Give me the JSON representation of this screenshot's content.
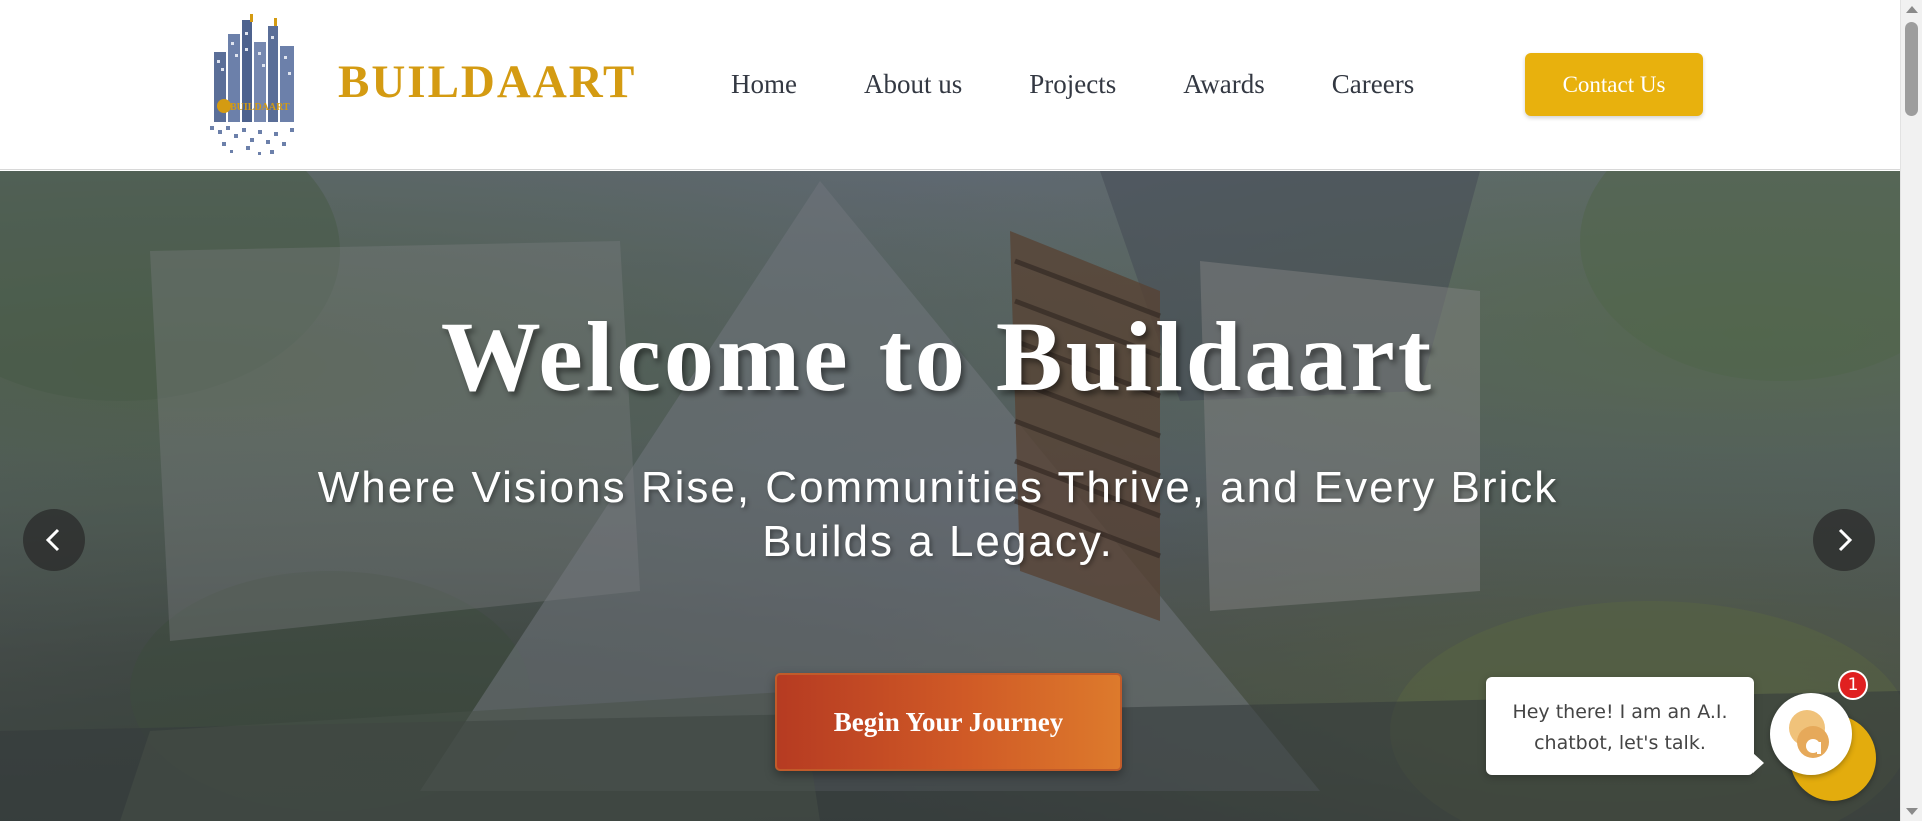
{
  "header": {
    "brand": "BUILDAART",
    "logo_mark_text": "BUILDAART",
    "nav": [
      {
        "label": "Home"
      },
      {
        "label": "About us"
      },
      {
        "label": "Projects"
      },
      {
        "label": "Awards"
      },
      {
        "label": "Careers"
      }
    ],
    "contact_label": "Contact Us"
  },
  "hero": {
    "title": "Welcome to Buildaart",
    "subtitle": "Where Visions Rise, Communities Thrive, and Every Brick Builds a Legacy.",
    "cta_label": "Begin Your Journey",
    "prev_icon": "chevron-left-icon",
    "next_icon": "chevron-right-icon"
  },
  "chat": {
    "message": "Hey there! I am an A.I. chatbot, let's talk.",
    "badge_count": "1"
  },
  "colors": {
    "brand_gold": "#d49b12",
    "contact_button": "#e8b10d",
    "cta_gradient_start": "#b63b22",
    "cta_gradient_end": "#dd7a2c",
    "badge_red": "#e02020",
    "nav_text": "#333842"
  }
}
